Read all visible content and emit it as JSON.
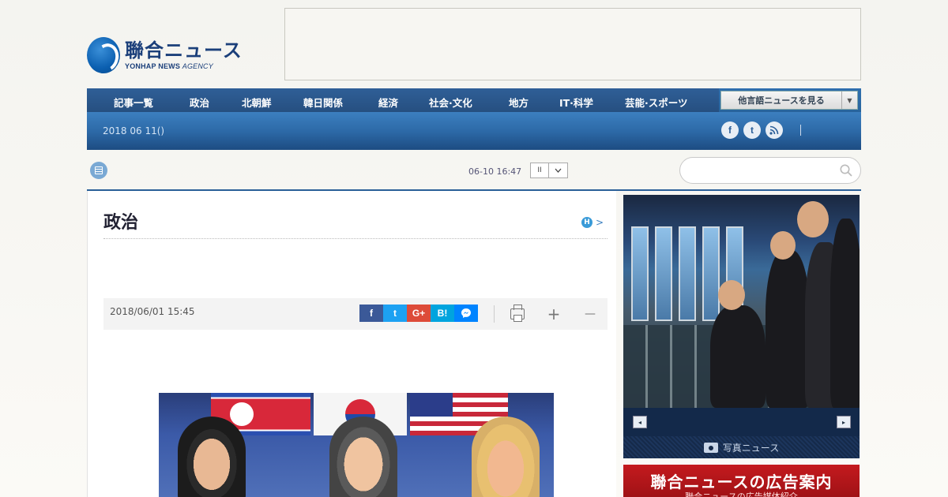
{
  "header": {
    "logo_jp": "聯合ニュース",
    "logo_en_bold": "YONHAP NEWS",
    "logo_en_italic": "AGENCY"
  },
  "nav": {
    "items": [
      "記事一覧",
      "政治",
      "北朝鮮",
      "韓日関係",
      "経済",
      "社会·文化",
      "地方",
      "IT·科学",
      "芸能·スポーツ"
    ],
    "language_select": "他言語ニュースを見る",
    "date": "2018 06 11()"
  },
  "social": {
    "facebook": "f",
    "twitter": "t",
    "rss": "rss"
  },
  "ticker": {
    "time": "06-10 16:47",
    "pause": "II",
    "dropdown": "∨"
  },
  "search": {
    "placeholder": ""
  },
  "article": {
    "section_title": "政治",
    "h_badge": "H",
    "h_arrow": ">",
    "date": "2018/06/01 15:45",
    "share": [
      "f",
      "t",
      "G+",
      "B!",
      "m"
    ],
    "share_colors": [
      "#3b5998",
      "#1da1f2",
      "#dd4b39",
      "#00a4de",
      "#0084ff"
    ],
    "tool_plus": "+",
    "tool_minus": "—"
  },
  "sidebar": {
    "prev": "◂",
    "next": "▸",
    "photo_caption": "写真ニュース",
    "ad_title": "聯合ニュースの広告案内",
    "ad_sub": "聯合ニュースの広告媒体紹介"
  }
}
